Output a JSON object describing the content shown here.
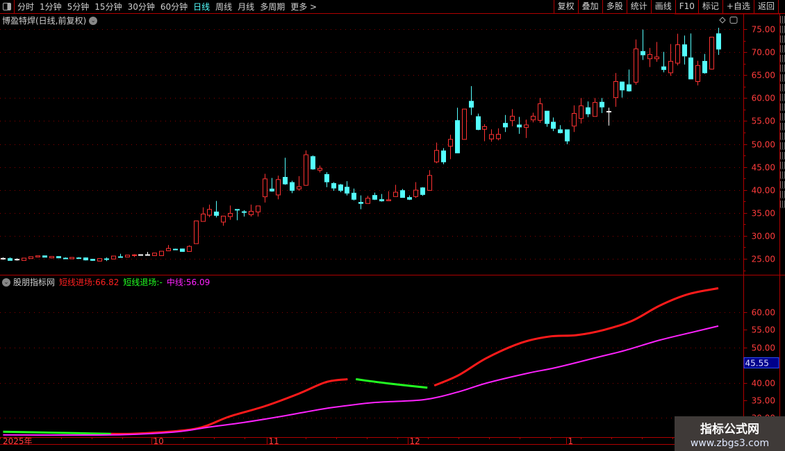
{
  "toolbar": {
    "periods": [
      {
        "label": "分时"
      },
      {
        "label": "1分钟"
      },
      {
        "label": "5分钟"
      },
      {
        "label": "15分钟"
      },
      {
        "label": "30分钟"
      },
      {
        "label": "60分钟"
      },
      {
        "label": "日线",
        "active": true
      },
      {
        "label": "周线"
      },
      {
        "label": "月线"
      },
      {
        "label": "多周期"
      },
      {
        "label": "更多 >"
      }
    ],
    "buttons": [
      {
        "label": "复权"
      },
      {
        "label": "叠加"
      },
      {
        "label": "多股"
      },
      {
        "label": "统计"
      },
      {
        "label": "画线"
      },
      {
        "label": "F10"
      },
      {
        "label": "标记"
      },
      {
        "label": "+自选"
      },
      {
        "label": "返回"
      }
    ]
  },
  "main": {
    "title": "博盈特焊(日线,前复权)",
    "icons": [
      "chevron-down-icon",
      "diamond-icon",
      "panel-toggle-icon"
    ]
  },
  "indicator": {
    "name": "股朋指标网",
    "entry_label": "短线进场:",
    "entry_value": "66.82",
    "exit_label": "短线退场:",
    "exit_value": "-",
    "mid_label": "中线:",
    "mid_value": "56.09",
    "cursor_value": "45.55"
  },
  "colors": {
    "up": "#ff3232",
    "down": "#54ffff",
    "flat": "#ffffff",
    "entry": "#ff1a1a",
    "exit": "#22ff22",
    "mid": "#ff22ff",
    "axis": "#b00000",
    "label": "#ff3c3c",
    "active_period": "#54ffff"
  },
  "watermark": {
    "line1": "指标公式网",
    "line2": "www.zbgs3.com"
  },
  "chart_data": [
    {
      "type": "candlestick",
      "yaxis_ticks": [
        "75.00",
        "70.00",
        "65.00",
        "60.00",
        "55.00",
        "50.00",
        "45.00",
        "40.00",
        "35.00",
        "30.00",
        "25.00"
      ],
      "ylim": [
        22.5,
        76.5
      ],
      "x_labels": [
        {
          "label": "2025年",
          "index": 0
        },
        {
          "label": "10",
          "index": 21.6
        },
        {
          "label": "11",
          "index": 38.3
        },
        {
          "label": "12",
          "index": 58.8
        },
        {
          "label": "1",
          "index": 81.9
        }
      ],
      "ohlc": [
        [
          25.1,
          25.3,
          24.8,
          25.1
        ],
        [
          25.05,
          25.3,
          24.6,
          24.65
        ],
        [
          24.9,
          25.1,
          24.6,
          24.9
        ],
        [
          24.65,
          25.2,
          24.6,
          25.15
        ],
        [
          25.05,
          25.5,
          25.0,
          25.45
        ],
        [
          25.4,
          25.7,
          25.35,
          25.65
        ],
        [
          25.65,
          25.7,
          25.3,
          25.35
        ],
        [
          25.2,
          25.55,
          25.1,
          25.5
        ],
        [
          25.5,
          25.55,
          25.15,
          25.2
        ],
        [
          25.15,
          25.3,
          25.0,
          25.14
        ],
        [
          25.0,
          25.35,
          24.95,
          25.3
        ],
        [
          25.2,
          25.35,
          25.05,
          25.19
        ],
        [
          25.2,
          25.3,
          24.65,
          24.75
        ],
        [
          24.9,
          24.95,
          24.55,
          24.65
        ],
        [
          24.5,
          25.1,
          24.45,
          25.05
        ],
        [
          25.0,
          25.3,
          24.5,
          24.99
        ],
        [
          24.95,
          25.65,
          24.9,
          25.6
        ],
        [
          25.45,
          26.1,
          25.4,
          25.44
        ],
        [
          25.4,
          25.85,
          25.35,
          25.8
        ],
        [
          25.85,
          26.0,
          25.4,
          25.86
        ],
        [
          25.9,
          25.95,
          25.85,
          25.9
        ],
        [
          25.9,
          26.5,
          25.85,
          25.9
        ],
        [
          25.7,
          26.3,
          25.65,
          26.25
        ],
        [
          25.7,
          26.7,
          25.65,
          26.65
        ],
        [
          26.75,
          28.0,
          26.7,
          27.25
        ],
        [
          27.1,
          27.2,
          26.9,
          27.09
        ],
        [
          27.15,
          27.2,
          26.55,
          26.6
        ],
        [
          26.6,
          27.95,
          26.55,
          27.7
        ],
        [
          28.3,
          33.3,
          28.25,
          33.25
        ],
        [
          33.15,
          36.2,
          33.1,
          34.75
        ],
        [
          34.5,
          36.8,
          34.05,
          35.75
        ],
        [
          35.2,
          37.6,
          34.0,
          34.45
        ],
        [
          33.0,
          34.35,
          32.2,
          34.3
        ],
        [
          34.2,
          36.6,
          33.5,
          34.9
        ],
        [
          35.75,
          35.8,
          33.4,
          35.7
        ],
        [
          35.25,
          35.6,
          34.2,
          35.2
        ],
        [
          34.6,
          36.8,
          34.2,
          35.35
        ],
        [
          35.2,
          36.55,
          34.2,
          36.5
        ],
        [
          38.5,
          43.5,
          37.25,
          42.4
        ],
        [
          40.2,
          42.6,
          39.6,
          39.75
        ],
        [
          38.9,
          43.1,
          37.95,
          42.25
        ],
        [
          42.75,
          47.0,
          41.1,
          41.3
        ],
        [
          41.6,
          42.0,
          39.3,
          39.9
        ],
        [
          40.2,
          43.0,
          39.8,
          40.7
        ],
        [
          41.0,
          48.6,
          40.9,
          47.65
        ],
        [
          47.25,
          47.5,
          44.4,
          44.55
        ],
        [
          44.3,
          45.3,
          43.8,
          44.7
        ],
        [
          43.35,
          43.85,
          40.6,
          41.75
        ],
        [
          41.4,
          41.7,
          39.8,
          40.4
        ],
        [
          41.1,
          41.3,
          39.5,
          39.9
        ],
        [
          40.6,
          41.9,
          38.8,
          39.3
        ],
        [
          39.3,
          40.3,
          37.7,
          37.95
        ],
        [
          37.3,
          38.8,
          35.8,
          37.05
        ],
        [
          37.05,
          38.7,
          37.0,
          38.2
        ],
        [
          38.8,
          39.4,
          37.8,
          37.95
        ],
        [
          37.9,
          39.1,
          37.45,
          37.6
        ],
        [
          37.65,
          39.7,
          37.6,
          37.85
        ],
        [
          38.55,
          41.1,
          38.5,
          39.5
        ],
        [
          39.85,
          40.2,
          38.3,
          38.35
        ],
        [
          38.35,
          38.8,
          37.8,
          37.95
        ],
        [
          38.55,
          41.7,
          38.25,
          39.95
        ],
        [
          40.45,
          40.6,
          38.7,
          39.0
        ],
        [
          39.9,
          44.3,
          39.85,
          43.15
        ],
        [
          46.1,
          50.3,
          45.8,
          48.6
        ],
        [
          48.5,
          49.1,
          45.6,
          46.1
        ],
        [
          49.5,
          52.0,
          46.7,
          51.0
        ],
        [
          55.1,
          57.9,
          48.0,
          48.05
        ],
        [
          51.0,
          57.65,
          50.95,
          57.6
        ],
        [
          59.3,
          62.6,
          56.3,
          58.0
        ],
        [
          55.95,
          56.6,
          53.0,
          53.15
        ],
        [
          53.2,
          54.3,
          50.6,
          53.8
        ],
        [
          51.1,
          53.2,
          50.5,
          52.05
        ],
        [
          51.15,
          53.4,
          50.8,
          52.1
        ],
        [
          54.5,
          56.3,
          52.6,
          53.7
        ],
        [
          55.1,
          57.6,
          53.85,
          56.05
        ],
        [
          54.15,
          55.9,
          52.2,
          53.7
        ],
        [
          53.6,
          55.3,
          51.3,
          54.15
        ],
        [
          55.25,
          56.8,
          54.7,
          56.05
        ],
        [
          55.15,
          60.05,
          54.6,
          58.75
        ],
        [
          57.15,
          57.2,
          53.75,
          54.45
        ],
        [
          54.75,
          55.75,
          52.8,
          53.4
        ],
        [
          53.1,
          54.1,
          52.3,
          52.45
        ],
        [
          53.1,
          53.15,
          49.95,
          50.65
        ],
        [
          53.9,
          58.4,
          52.6,
          56.65
        ],
        [
          55.55,
          60.0,
          54.45,
          58.3
        ],
        [
          57.9,
          59.25,
          55.85,
          56.55
        ],
        [
          56.0,
          60.0,
          55.95,
          59.05
        ],
        [
          59.1,
          60.0,
          56.75,
          58.05
        ],
        [
          57.1,
          57.9,
          54.0,
          57.1
        ],
        [
          60.1,
          65.45,
          58.1,
          63.6
        ],
        [
          63.5,
          63.6,
          60.1,
          61.75
        ],
        [
          62.9,
          66.2,
          61.4,
          61.55
        ],
        [
          63.45,
          72.75,
          62.9,
          70.7
        ],
        [
          70.15,
          74.9,
          68.3,
          69.4
        ],
        [
          68.55,
          70.9,
          66.75,
          69.5
        ],
        [
          68.55,
          72.2,
          67.9,
          68.95
        ],
        [
          66.8,
          70.05,
          65.6,
          66.2
        ],
        [
          65.5,
          71.75,
          64.85,
          68.0
        ],
        [
          67.6,
          74.0,
          67.1,
          71.6
        ],
        [
          71.6,
          73.6,
          67.3,
          69.15
        ],
        [
          68.75,
          74.05,
          64.1,
          64.15
        ],
        [
          63.6,
          68.1,
          62.75,
          67.1
        ],
        [
          68.0,
          69.6,
          65.3,
          65.5
        ],
        [
          66.3,
          73.3,
          66.2,
          73.25
        ],
        [
          74.0,
          75.3,
          69.4,
          70.65
        ]
      ]
    },
    {
      "type": "line",
      "yaxis_ticks": [
        "60.00",
        "55.00",
        "50.00",
        "45.00",
        "40.00",
        "35.00",
        "30.00"
      ],
      "ylim": [
        23.5,
        66.8
      ],
      "series": [
        {
          "name": "短线进场",
          "color": "entry",
          "segments": [
            [
              [
                15.7,
                25.5
              ],
              [
                19.8,
                25.6
              ],
              [
                27.9,
                26.9
              ],
              [
                32.9,
                30.4
              ],
              [
                38,
                33.3
              ],
              [
                43,
                36.9
              ],
              [
                47,
                40.2
              ],
              [
                50.1,
                41
              ]
            ],
            [
              [
                62.7,
                39.2
              ],
              [
                66.2,
                42.1
              ],
              [
                70.3,
                47
              ],
              [
                75.3,
                51.3
              ],
              [
                79.4,
                53.1
              ],
              [
                83.4,
                53.5
              ],
              [
                87.4,
                55
              ],
              [
                91.5,
                57.6
              ],
              [
                95.5,
                61.9
              ],
              [
                99.6,
                65.1
              ],
              [
                104,
                66.82
              ]
            ]
          ]
        },
        {
          "name": "短线退场",
          "color": "exit",
          "segments": [
            [
              [
                0,
                26.1
              ],
              [
                8,
                25.8
              ],
              [
                15.7,
                25.5
              ]
            ],
            [
              [
                51.3,
                41
              ],
              [
                56,
                39.8
              ],
              [
                61.7,
                38.6
              ]
            ]
          ]
        },
        {
          "name": "中线",
          "color": "mid",
          "segments": [
            [
              [
                0,
                25.2
              ],
              [
                15.7,
                25.2
              ],
              [
                24.8,
                26
              ],
              [
                29.9,
                27.4
              ],
              [
                34.9,
                28.7
              ],
              [
                40,
                30.3
              ],
              [
                44,
                31.7
              ],
              [
                48,
                33
              ],
              [
                54.1,
                34.4
              ],
              [
                61.2,
                35.2
              ],
              [
                66.2,
                37.4
              ],
              [
                70.3,
                39.9
              ],
              [
                76.3,
                42.7
              ],
              [
                80.4,
                44.3
              ],
              [
                86.4,
                47.2
              ],
              [
                90.5,
                49.2
              ],
              [
                95.5,
                52.1
              ],
              [
                100.6,
                54.5
              ],
              [
                104,
                56.09
              ]
            ]
          ]
        }
      ]
    }
  ]
}
